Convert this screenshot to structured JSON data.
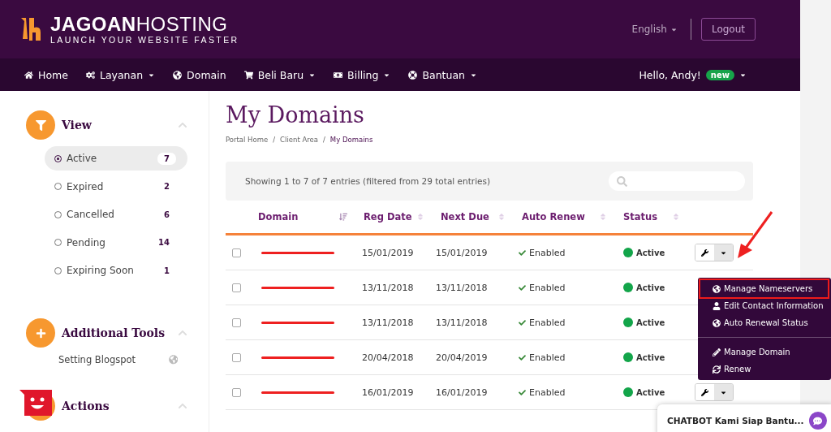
{
  "brand": {
    "name_bold": "JAGOAN",
    "name_light": "HOSTING",
    "tagline": "LAUNCH YOUR WEBSITE FASTER"
  },
  "language": "English",
  "logout": "Logout",
  "nav": [
    {
      "label": "Home",
      "caret": false
    },
    {
      "label": "Layanan",
      "caret": true
    },
    {
      "label": "Domain",
      "caret": false
    },
    {
      "label": "Beli Baru",
      "caret": true
    },
    {
      "label": "Billing",
      "caret": true
    },
    {
      "label": "Bantuan",
      "caret": true
    }
  ],
  "user": {
    "greeting": "Hello, Andy!",
    "badge": "new"
  },
  "sidebar": [
    {
      "title": "View",
      "items": [
        {
          "label": "Active",
          "count": "7",
          "selected": true
        },
        {
          "label": "Expired",
          "count": "2",
          "selected": false
        },
        {
          "label": "Cancelled",
          "count": "6",
          "selected": false
        },
        {
          "label": "Pending",
          "count": "14",
          "selected": false
        },
        {
          "label": "Expiring Soon",
          "count": "1",
          "selected": false
        }
      ]
    },
    {
      "title": "Additional Tools",
      "links": [
        {
          "label": "Setting Blogspot"
        }
      ]
    },
    {
      "title": "Actions"
    }
  ],
  "page_title": "My Domains",
  "breadcrumb_separators": [
    "/",
    "/"
  ],
  "breadcrumb": [
    {
      "label": "Portal Home",
      "selected": false
    },
    {
      "label": "Client Area",
      "selected": false
    },
    {
      "label": "My Domains",
      "selected": true
    }
  ],
  "table": {
    "info": "Showing 1 to 7 of 7 entries (filtered from 29 total entries)",
    "columns": [
      {
        "label": "Domain",
        "sorted": true
      },
      {
        "label": "Reg Date",
        "sorted": false
      },
      {
        "label": "Next Due",
        "sorted": false
      },
      {
        "label": "Auto Renew",
        "sorted": false
      },
      {
        "label": "Status",
        "sorted": false
      }
    ],
    "rows": [
      {
        "checked": false,
        "reg_date": "15/01/2019",
        "next_due": "15/01/2019",
        "auto_renew": "Enabled",
        "status": "Active",
        "actions": true
      },
      {
        "checked": false,
        "reg_date": "13/11/2018",
        "next_due": "13/11/2018",
        "auto_renew": "Enabled",
        "status": "Active",
        "actions": false
      },
      {
        "checked": false,
        "reg_date": "13/11/2018",
        "next_due": "13/11/2018",
        "auto_renew": "Enabled",
        "status": "Active",
        "actions": false
      },
      {
        "checked": false,
        "reg_date": "20/04/2018",
        "next_due": "20/04/2019",
        "auto_renew": "Enabled",
        "status": "Active",
        "actions": false
      },
      {
        "checked": false,
        "reg_date": "16/01/2019",
        "next_due": "16/01/2019",
        "auto_renew": "Enabled",
        "status": "Active",
        "actions": true
      }
    ]
  },
  "dropdown": [
    {
      "label": "Manage Nameservers",
      "highlighted": true
    },
    {
      "label": "Edit Contact Information",
      "highlighted": false
    },
    {
      "label": "Auto Renewal Status",
      "highlighted": false
    },
    {
      "label": "Manage Domain",
      "highlighted": false,
      "divider_before": true
    },
    {
      "label": "Renew",
      "highlighted": false
    }
  ],
  "chatbot": {
    "label": "CHATBOT Kami Siap Bantu..."
  }
}
